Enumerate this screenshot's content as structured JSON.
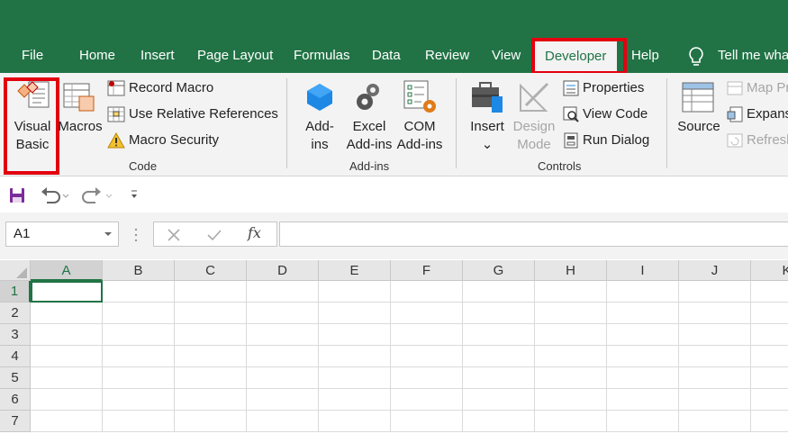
{
  "tabs": {
    "file": "File",
    "home": "Home",
    "insert": "Insert",
    "page_layout": "Page Layout",
    "formulas": "Formulas",
    "data": "Data",
    "review": "Review",
    "view": "View",
    "developer": "Developer",
    "help": "Help",
    "tell_me": "Tell me wha"
  },
  "code_group": {
    "visual_basic_l1": "Visual",
    "visual_basic_l2": "Basic",
    "macros": "Macros",
    "record_macro": "Record Macro",
    "use_relative": "Use Relative References",
    "macro_security": "Macro Security",
    "label": "Code"
  },
  "addins_group": {
    "addins_l1": "Add-",
    "addins_l2": "ins",
    "excel_addins_l1": "Excel",
    "excel_addins_l2": "Add-ins",
    "com_addins_l1": "COM",
    "com_addins_l2": "Add-ins",
    "label": "Add-ins"
  },
  "controls_group": {
    "insert": "Insert",
    "design_mode_l1": "Design",
    "design_mode_l2": "Mode",
    "properties": "Properties",
    "view_code": "View Code",
    "run_dialog": "Run Dialog",
    "label": "Controls"
  },
  "xml_group": {
    "source": "Source",
    "map_properties": "Map Pr",
    "expansion_packs": "Expans",
    "refresh_data": "Refresh"
  },
  "formula_bar": {
    "name_box": "A1",
    "fx": "fx",
    "value": ""
  },
  "columns": [
    "A",
    "B",
    "C",
    "D",
    "E",
    "F",
    "G",
    "H",
    "I",
    "J",
    "K"
  ],
  "rows": [
    "1",
    "2",
    "3",
    "4",
    "5",
    "6",
    "7"
  ],
  "colors": {
    "accent": "#217346",
    "highlight": "#e3000f"
  }
}
